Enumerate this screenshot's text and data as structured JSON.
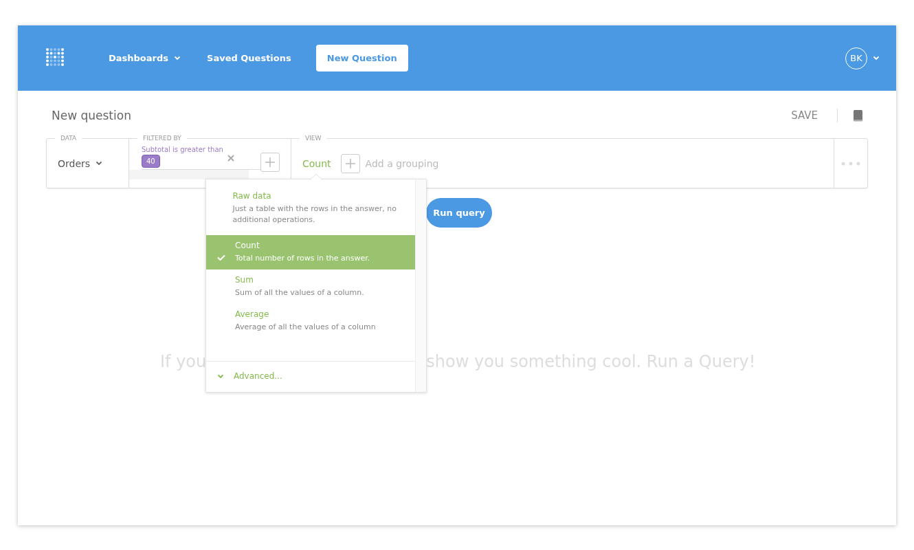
{
  "nav": {
    "items": [
      {
        "label": "Dashboards",
        "dropdown": true,
        "selected": false
      },
      {
        "label": "Saved Questions",
        "dropdown": false,
        "selected": false
      },
      {
        "label": "New Question",
        "dropdown": false,
        "selected": true
      }
    ],
    "avatar": "BK"
  },
  "page_title": "New question",
  "save": "SAVE",
  "query": {
    "data": {
      "label": "DATA",
      "table": "Orders"
    },
    "filter": {
      "label": "FILTERED BY",
      "text": "Subtotal is greater than",
      "value": "40"
    },
    "view": {
      "label": "VIEW",
      "aggregation": "Count",
      "grouping_placeholder": "Add a grouping"
    }
  },
  "aggregation_menu": {
    "options": [
      {
        "title": "Raw data",
        "description": "Just a table with the rows in the answer, no additional operations.",
        "selected": false
      },
      {
        "title": "Count",
        "description": "Total number of rows in the answer.",
        "selected": true
      },
      {
        "title": "Sum",
        "description": "Sum of all the values of a column.",
        "selected": false
      },
      {
        "title": "Average",
        "description": "Average of all the values of a column",
        "selected": false
      }
    ],
    "advanced": "Advanced..."
  },
  "run_button": "Run query",
  "empty_message": [
    "If you",
    "show you something cool. Run a Query!"
  ]
}
